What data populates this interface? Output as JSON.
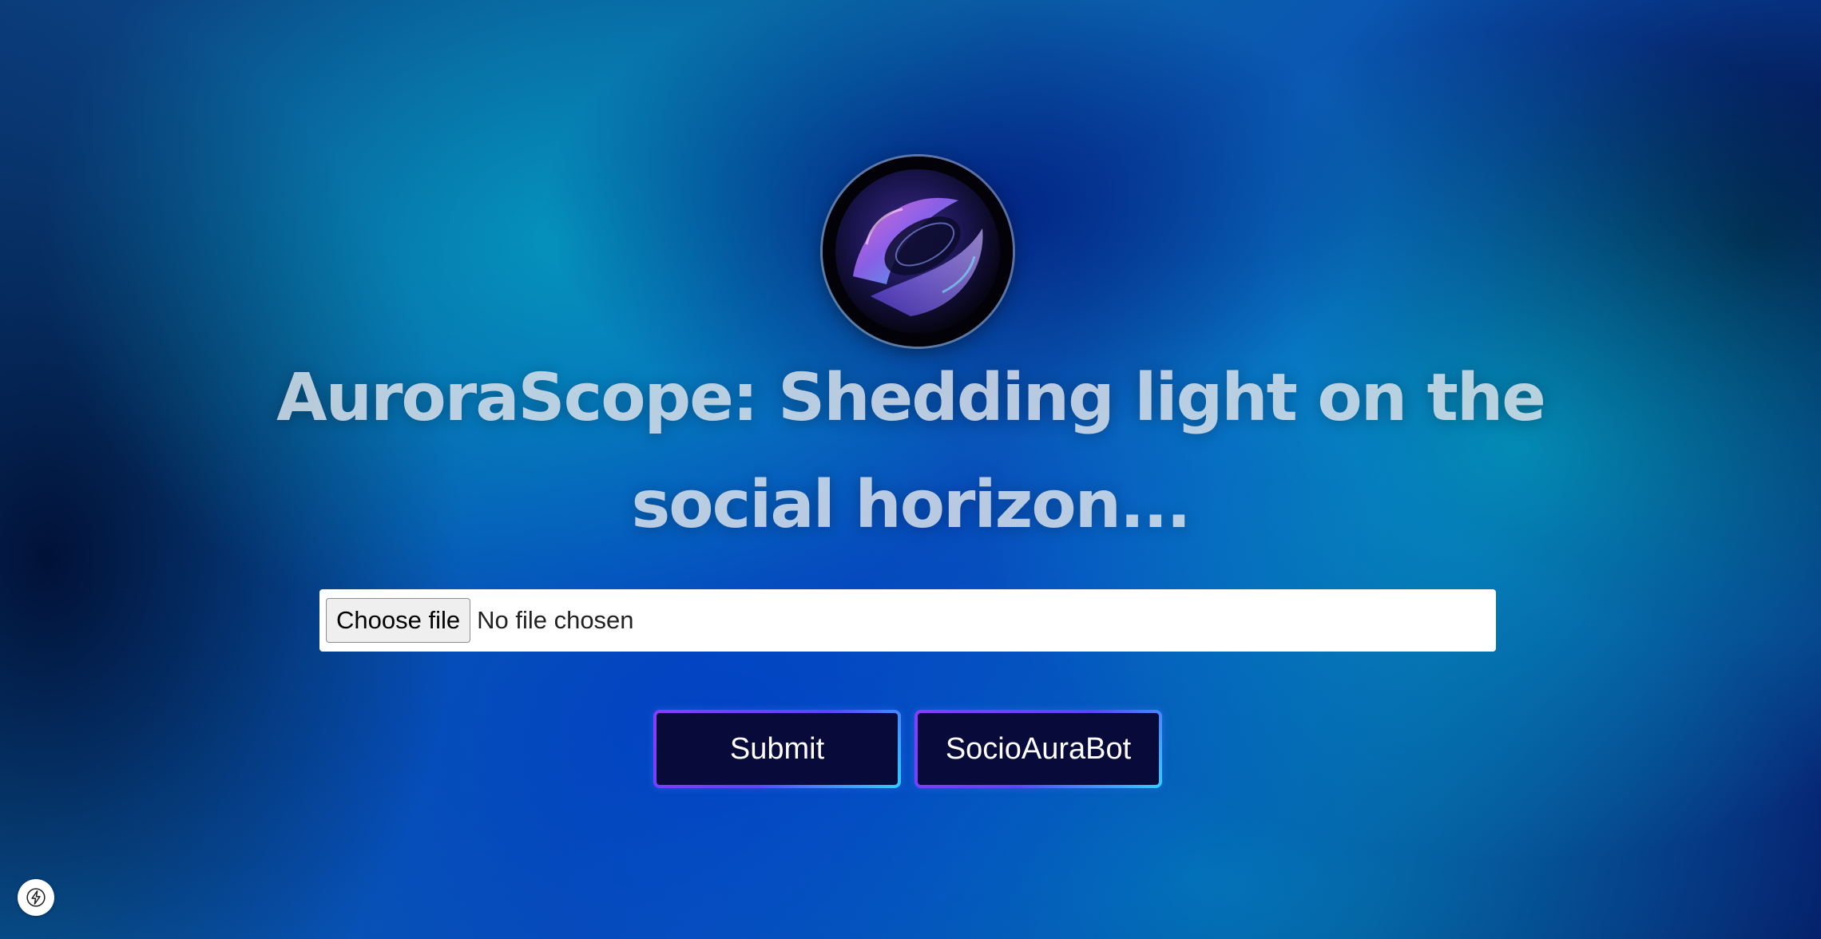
{
  "header": {
    "title": "AuroraScope: Shedding light on the social horizon..."
  },
  "upload": {
    "button_label": "Choose file",
    "status_text": "No file chosen"
  },
  "actions": {
    "submit_label": "Submit",
    "bot_label": "SocioAuraBot"
  },
  "logo": {
    "icon": "aurora-orb-logo"
  },
  "badge": {
    "icon": "lightning-bolt-icon"
  },
  "colors": {
    "button_bg": "#080a3a",
    "button_border_start": "#8a3cff",
    "button_border_end": "#2fd0ff",
    "title_color": "#e1e8f0"
  }
}
